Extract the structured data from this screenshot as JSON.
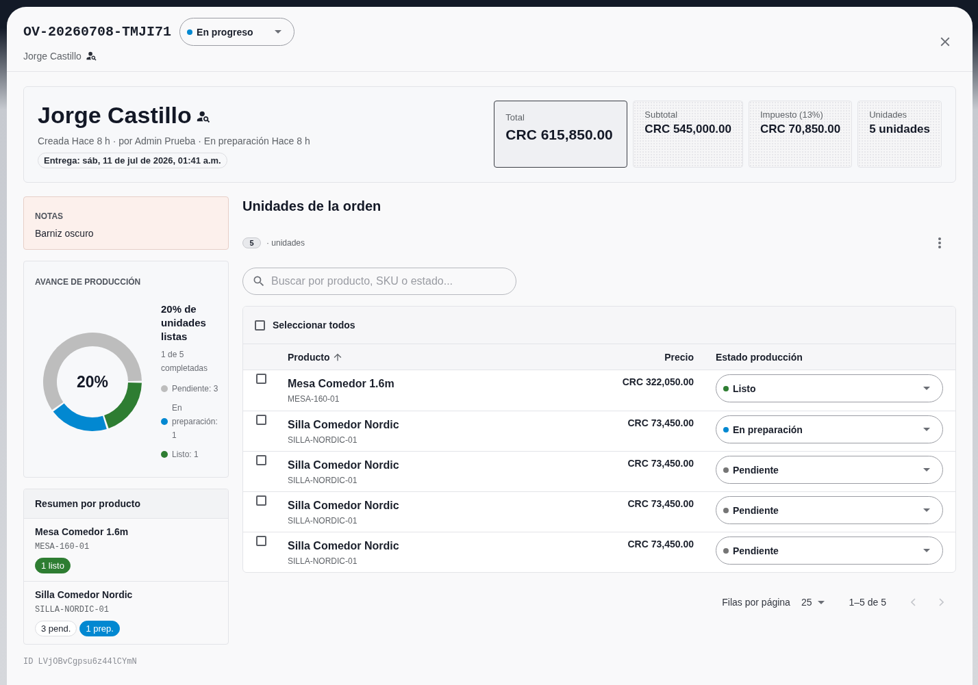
{
  "header": {
    "order_id": "OV-20260708-TMJI71",
    "status": {
      "label": "En progreso",
      "color": "#0288d1"
    },
    "customer": "Jorge Castillo"
  },
  "summary": {
    "customer_name": "Jorge Castillo",
    "meta": "Creada Hace 8 h · por Admin Prueba · En preparación Hace 8 h",
    "delivery": "Entrega: sáb, 11 de jul de 2026, 01:41 a.m.",
    "stats": [
      {
        "label": "Total",
        "value": "CRC 615,850.00",
        "emphasized": true
      },
      {
        "label": "Subtotal",
        "value": "CRC 545,000.00",
        "emphasized": false
      },
      {
        "label": "Impuesto (13%)",
        "value": "CRC 70,850.00",
        "emphasized": false
      },
      {
        "label": "Unidades",
        "value": "5 unidades",
        "emphasized": false
      }
    ]
  },
  "notes": {
    "label": "NOTAS",
    "text": "Barniz oscuro"
  },
  "progress": {
    "title": "AVANCE DE PRODUCCIÓN",
    "center_label": "20%",
    "headline": "20% de unidades listas",
    "detail": "1 de 5 completadas",
    "legend": [
      {
        "label": "Pendiente: 3",
        "color": "#bdbdbd"
      },
      {
        "label": "En preparación: 1",
        "color": "#0288d1"
      },
      {
        "label": "Listo: 1",
        "color": "#2e7d32"
      }
    ],
    "chart_data": {
      "type": "donut",
      "values": [
        60,
        20,
        20
      ],
      "colors": [
        "#bdbdbd",
        "#0288d1",
        "#2e7d32"
      ]
    }
  },
  "product_summary": {
    "title": "Resumen por producto",
    "items": [
      {
        "name": "Mesa Comedor 1.6m",
        "sku": "MESA-160-01",
        "badges": [
          {
            "label": "1 listo",
            "kind": "ready"
          }
        ]
      },
      {
        "name": "Silla Comedor Nordic",
        "sku": "SILLA-NORDIC-01",
        "badges": [
          {
            "label": "3 pend.",
            "kind": "pending"
          },
          {
            "label": "1 prep.",
            "kind": "prep"
          }
        ]
      }
    ]
  },
  "record_id": "ID LVjOBvCgpsu6z44lCYmN",
  "units": {
    "title": "Unidades de la orden",
    "count": "5",
    "count_label": "· unidades",
    "search": {
      "placeholder": "Buscar por producto, SKU o estado..."
    },
    "select_all": {
      "label": "Seleccionar todos",
      "checked": false
    },
    "table": {
      "columns": [
        {
          "label": "Producto",
          "sorted": true,
          "ascending": true
        },
        {
          "label": "Precio",
          "sorted": false
        },
        {
          "label": "Estado producción",
          "sorted": false
        }
      ],
      "rows": [
        {
          "checked": false,
          "name": "Mesa Comedor 1.6m",
          "sku": "MESA-160-01",
          "price": "CRC 322,050.00",
          "status": {
            "label": "Listo",
            "color": "#2e7d32"
          }
        },
        {
          "checked": false,
          "name": "Silla Comedor Nordic",
          "sku": "SILLA-NORDIC-01",
          "price": "CRC 73,450.00",
          "status": {
            "label": "En preparación",
            "color": "#0288d1"
          }
        },
        {
          "checked": false,
          "name": "Silla Comedor Nordic",
          "sku": "SILLA-NORDIC-01",
          "price": "CRC 73,450.00",
          "status": {
            "label": "Pendiente",
            "color": "#757575"
          }
        },
        {
          "checked": false,
          "name": "Silla Comedor Nordic",
          "sku": "SILLA-NORDIC-01",
          "price": "CRC 73,450.00",
          "status": {
            "label": "Pendiente",
            "color": "#757575"
          }
        },
        {
          "checked": false,
          "name": "Silla Comedor Nordic",
          "sku": "SILLA-NORDIC-01",
          "price": "CRC 73,450.00",
          "status": {
            "label": "Pendiente",
            "color": "#757575"
          }
        }
      ]
    },
    "pagination": {
      "rows_per_page_label": "Filas por página",
      "rows_per_page": "25",
      "range": "1–5 de 5",
      "prev_disabled": true,
      "next_disabled": true
    }
  }
}
